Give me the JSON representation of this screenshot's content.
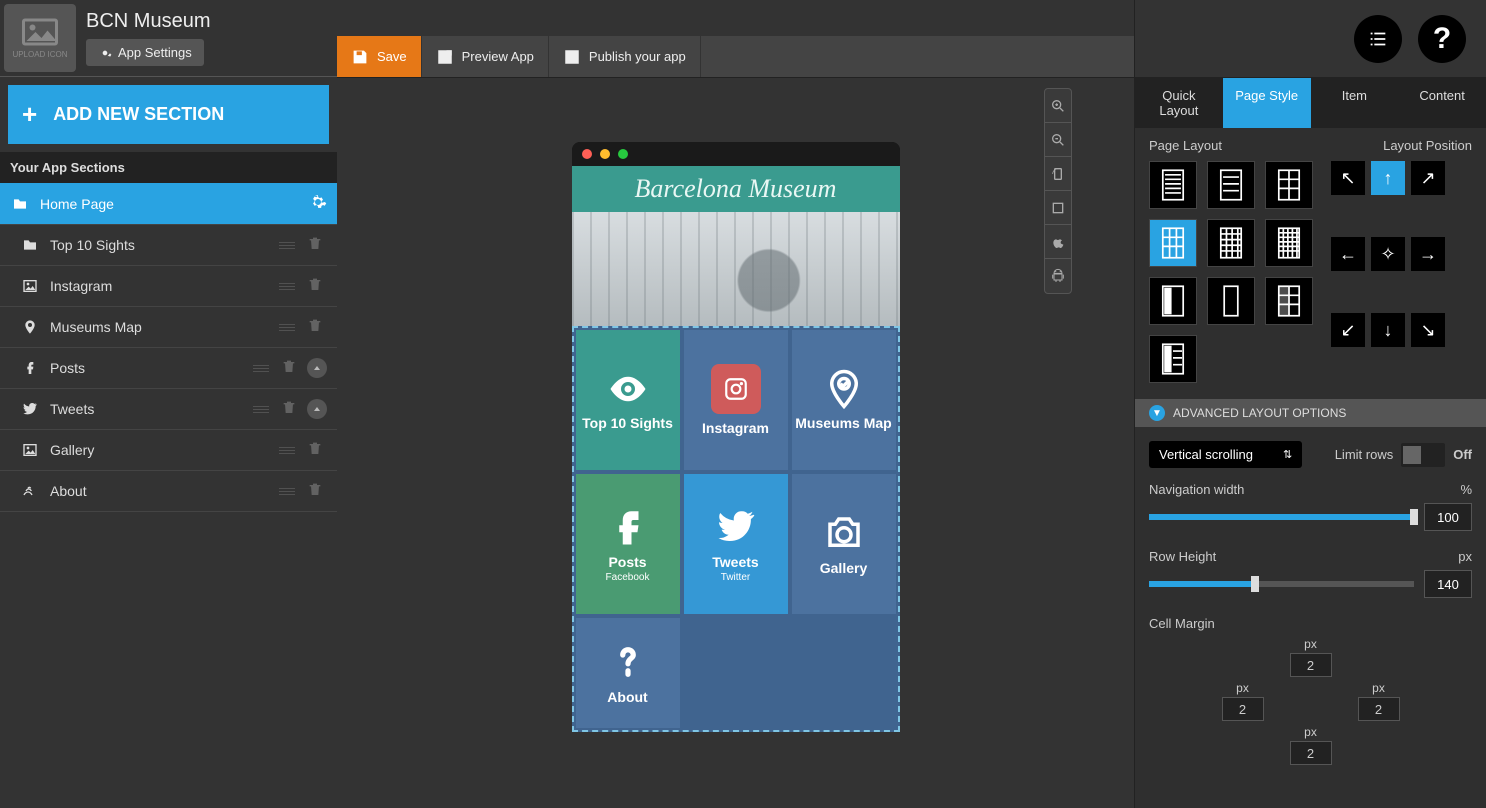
{
  "header": {
    "upload_label": "UPLOAD ICON",
    "app_title": "BCN Museum",
    "settings_label": "App Settings"
  },
  "sidebar": {
    "add_section": "ADD NEW SECTION",
    "sections_header": "Your App Sections",
    "items": [
      {
        "label": "Home Page"
      },
      {
        "label": "Top 10 Sights"
      },
      {
        "label": "Instagram"
      },
      {
        "label": "Museums Map"
      },
      {
        "label": "Posts"
      },
      {
        "label": "Tweets"
      },
      {
        "label": "Gallery"
      },
      {
        "label": "About"
      }
    ]
  },
  "toolbar": {
    "save": "Save",
    "preview": "Preview App",
    "publish": "Publish your app"
  },
  "preview": {
    "hero_title": "Barcelona Museum",
    "tiles": [
      {
        "label": "Top 10 Sights"
      },
      {
        "label": "Instagram"
      },
      {
        "label": "Museums Map"
      },
      {
        "label": "Posts",
        "sub": "Facebook"
      },
      {
        "label": "Tweets",
        "sub": "Twitter"
      },
      {
        "label": "Gallery"
      },
      {
        "label": "About"
      }
    ]
  },
  "right": {
    "tabs": [
      "Quick Layout",
      "Page Style",
      "Item",
      "Content"
    ],
    "page_layout_label": "Page Layout",
    "layout_position_label": "Layout Position",
    "advanced_label": "ADVANCED LAYOUT OPTIONS",
    "scroll_select": "Vertical scrolling",
    "limit_rows_label": "Limit rows",
    "limit_rows_value": "Off",
    "nav_width_label": "Navigation width",
    "nav_width_unit": "%",
    "nav_width_value": "100",
    "row_height_label": "Row Height",
    "row_height_unit": "px",
    "row_height_value": "140",
    "cell_margin_label": "Cell Margin",
    "px": "px",
    "margin": {
      "top": "2",
      "left": "2",
      "right": "2",
      "bottom": "2"
    }
  }
}
